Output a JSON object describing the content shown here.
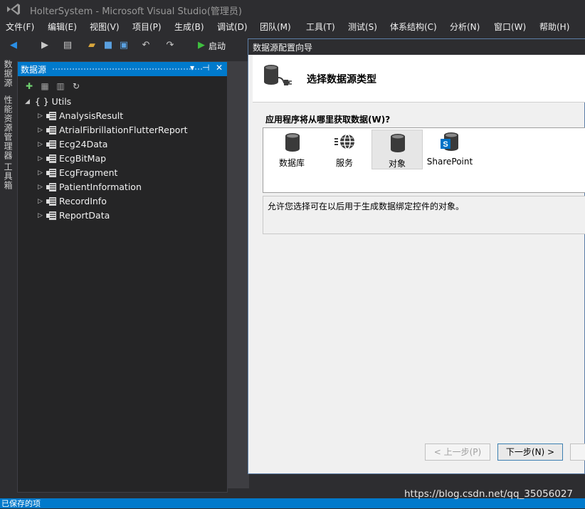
{
  "window": {
    "title": "HolterSystem - Microsoft Visual Studio(管理员)"
  },
  "menu": [
    {
      "label": "文件(F)"
    },
    {
      "label": "编辑(E)"
    },
    {
      "label": "视图(V)"
    },
    {
      "label": "项目(P)"
    },
    {
      "label": "生成(B)"
    },
    {
      "label": "调试(D)"
    },
    {
      "label": "团队(M)"
    },
    {
      "label": "工具(T)"
    },
    {
      "label": "测试(S)"
    },
    {
      "label": "体系结构(C)"
    },
    {
      "label": "分析(N)"
    },
    {
      "label": "窗口(W)"
    },
    {
      "label": "帮助(H)"
    }
  ],
  "toolbar": {
    "start_label": "启动"
  },
  "side_tabs": [
    {
      "label": "数据源"
    },
    {
      "label": "性能资源管理器"
    },
    {
      "label": "工具箱"
    }
  ],
  "data_sources": {
    "title": "数据源",
    "tree": {
      "root": "{ } Utils",
      "items": [
        {
          "label": "AnalysisResult"
        },
        {
          "label": "AtrialFibrillationFlutterReport"
        },
        {
          "label": "Ecg24Data"
        },
        {
          "label": "EcgBitMap"
        },
        {
          "label": "EcgFragment"
        },
        {
          "label": "PatientInformation"
        },
        {
          "label": "RecordInfo"
        },
        {
          "label": "ReportData"
        }
      ]
    }
  },
  "dialog": {
    "title": "数据源配置向导",
    "heading": "选择数据源类型",
    "question": "应用程序将从哪里获取数据(W)?",
    "types": [
      {
        "label": "数据库",
        "icon": "database-icon"
      },
      {
        "label": "服务",
        "icon": "service-icon"
      },
      {
        "label": "对象",
        "icon": "object-icon",
        "selected": true
      },
      {
        "label": "SharePoint",
        "icon": "sharepoint-icon"
      }
    ],
    "description": "允许您选择可在以后用于生成数据绑定控件的对象。",
    "buttons": {
      "prev": "< 上一步(P)",
      "next": "下一步(N) >"
    }
  },
  "status": {
    "text": "已保存的项"
  },
  "watermark": "https://blog.csdn.net/qq_35056027",
  "colors": {
    "accent": "#007acc",
    "background": "#2d2d30",
    "panel": "#252526"
  }
}
